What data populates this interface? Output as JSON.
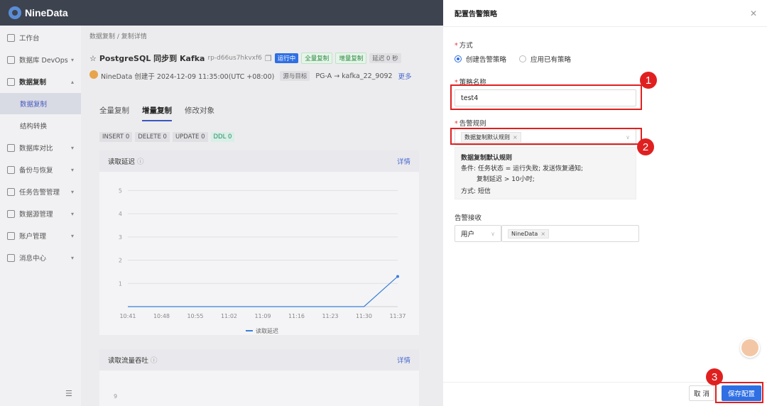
{
  "app": {
    "brand": "NineData"
  },
  "sidebar": {
    "items": [
      {
        "label": "工作台"
      },
      {
        "label": "数据库 DevOps"
      },
      {
        "label": "数据复制"
      },
      {
        "label": "数据复制"
      },
      {
        "label": "结构转换"
      },
      {
        "label": "数据库对比"
      },
      {
        "label": "备份与恢复"
      },
      {
        "label": "任务告警管理"
      },
      {
        "label": "数据源管理"
      },
      {
        "label": "账户管理"
      },
      {
        "label": "消息中心"
      }
    ],
    "collapse_icon": "collapse-icon"
  },
  "main": {
    "breadcrumb": "数据复制 / 复制详情",
    "title": "PostgreSQL 同步到 Kafka",
    "task_id": "rp-d66us7hkvxf6",
    "tag_running": "运行中",
    "tag_full": "全量复制",
    "tag_incr": "增量复制",
    "tag_delay": "延迟 0 秒",
    "meta_created": "NineData 创建于 2024-12-09 11:35:00(UTC +08:00)",
    "meta_source_label": "源与目标",
    "meta_source_value": "PG-A → kafka_22_9092",
    "meta_more": "更多",
    "tabs": [
      "全量复制",
      "增量复制",
      "修改对象"
    ],
    "counters": [
      "INSERT 0",
      "DELETE 0",
      "UPDATE 0",
      "DDL 0"
    ],
    "panel1_title": "读取延迟",
    "panel1_detail": "详情",
    "panel2_title": "读取流量吞吐",
    "panel2_detail": "详情",
    "legend": "读取延迟"
  },
  "chart_data": {
    "type": "line",
    "title": "读取延迟",
    "x": [
      "10:41",
      "10:48",
      "10:55",
      "11:02",
      "11:09",
      "11:16",
      "11:23",
      "11:30",
      "11:37"
    ],
    "yticks": [
      1,
      2,
      3,
      4,
      5
    ],
    "ylim": [
      0,
      5.5
    ],
    "series": [
      {
        "name": "读取延迟",
        "values": [
          0,
          0,
          0,
          0,
          0,
          0,
          0,
          0,
          1.3
        ]
      }
    ],
    "panel2_ytick": "9"
  },
  "drawer": {
    "title": "配置告警策略",
    "method_label": "方式",
    "method_options": [
      "创建告警策略",
      "应用已有策略"
    ],
    "name_label": "策略名称",
    "name_value": "test4",
    "rule_label": "告警规则",
    "rule_chip": "数据复制默认规则",
    "rule_box_title": "数据复制默认规则",
    "rule_cond_line1": "条件: 任务状态 = 运行失败; 发送恢复通知;",
    "rule_cond_line2": "复制延迟 > 10小时;",
    "rule_method": "方式: 短信",
    "receive_label": "告警接收",
    "receive_type": "用户",
    "receive_chip": "NineData",
    "cancel": "取 消",
    "save": "保存配置"
  },
  "annotations": [
    "1",
    "2",
    "3"
  ],
  "colors": {
    "primary": "#2f6fe4",
    "annotation": "#e02020"
  }
}
